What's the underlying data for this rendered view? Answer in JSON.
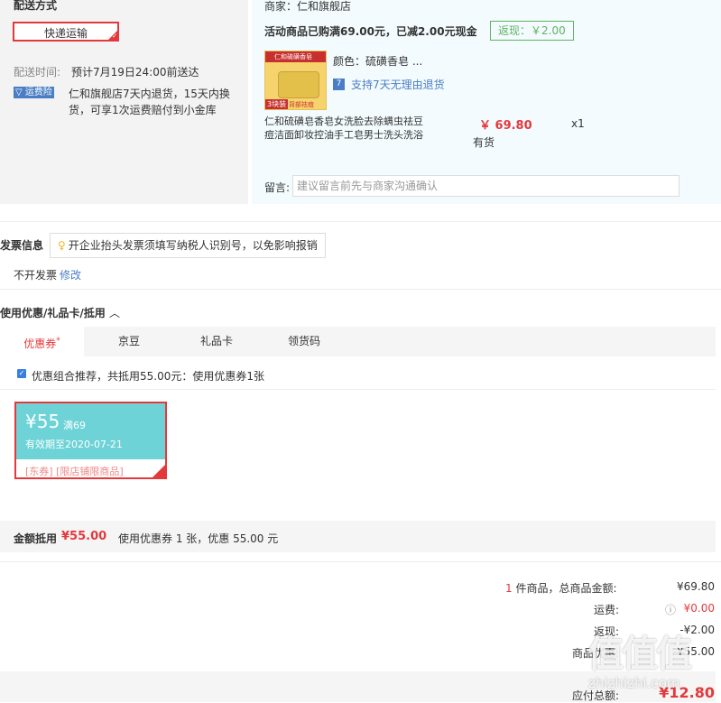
{
  "shipping": {
    "title": "配送方式",
    "method_button": "快递运输",
    "time_label": "配送时间:",
    "time_value": "预计7月19日24:00前送达",
    "insurance_badge": "运费险",
    "insurance_line1": "仁和旗舰店7天内退货，15天内换",
    "insurance_line2": "货，可享1次运费赔付到小金库"
  },
  "store": {
    "merchant": "商家：仁和旗舰店",
    "promo": "活动商品已购满69.00元，已减2.00元现金",
    "rebate": "返现：￥2.00",
    "product": {
      "color_label": "颜色：硫磺香皂 ...",
      "return_policy": "支持7天无理由退货",
      "name_line1": "仁和硫磺皂香皂女洗脸去除螨虫祛豆",
      "name_line2": "痘洁面卸妆控油手工皂男士洗头洗浴",
      "price": "￥ 69.80",
      "stock": "有货",
      "quantity": "x1",
      "img_band_text": "仁和硫磺香皂",
      "img_badge": "3块装",
      "img_badge2": "背部祛痘"
    },
    "note_label": "留言:",
    "note_placeholder": "建议留言前先与商家沟通确认"
  },
  "invoice": {
    "title": "发票信息",
    "tip": "开企业抬头发票须填写纳税人识别号，以免影响报销",
    "status": "不开发票",
    "edit_link": "修改"
  },
  "coupons": {
    "section_title": "使用优惠/礼品卡/抵用",
    "tabs": [
      "优惠券",
      "京豆",
      "礼品卡",
      "领货码"
    ],
    "active_tab_mark": "*",
    "combo_text": "优惠组合推荐，共抵用55.00元：使用优惠券1张",
    "card": {
      "amount": "¥55",
      "threshold": "满69",
      "validity": "有效期至2020-07-21",
      "tags": "[东券] [限店铺限商品]"
    },
    "summary_label": "金额抵用",
    "summary_amount": "¥55.00",
    "summary_detail": "使用优惠券 1 张，优惠 55.00 元"
  },
  "totals": {
    "count": "1",
    "count_label": "件商品，总商品金额:",
    "goods_amount": "¥69.80",
    "shipping_label": "运费:",
    "shipping_amount": "¥0.00",
    "cashback_label": "返现:",
    "cashback_amount": "-¥2.00",
    "coupon_label": "商品优惠:",
    "coupon_amount": "-¥55.00",
    "payable_label": "应付总额:",
    "payable_amount": "¥12.80"
  },
  "watermark": {
    "logo": "值值值",
    "site": "zhizhizhi.com"
  }
}
